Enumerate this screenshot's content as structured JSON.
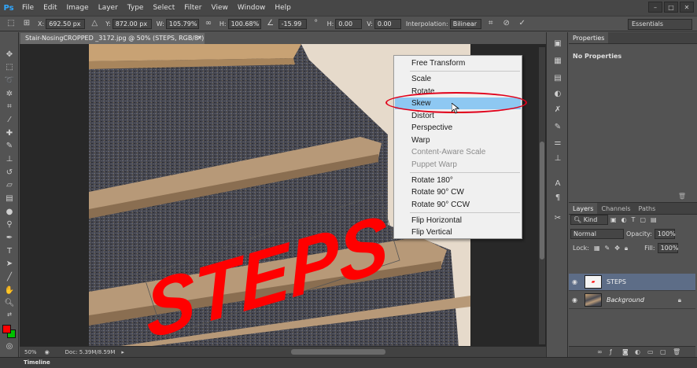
{
  "app": {
    "logo": "Ps",
    "menu": [
      "File",
      "Edit",
      "Image",
      "Layer",
      "Type",
      "Select",
      "Filter",
      "View",
      "Window",
      "Help"
    ],
    "window_controls": [
      "–",
      "□",
      "✕"
    ]
  },
  "options_bar": {
    "x_label": "X:",
    "x_value": "692.50 px",
    "y_label": "Y:",
    "y_value": "872.00 px",
    "w_label": "W:",
    "w_value": "105.79%",
    "h_label": "H:",
    "h_value": "100.68%",
    "angle_value": "-15.99",
    "hskew_label": "H:",
    "hskew_value": "0.00",
    "vskew_label": "V:",
    "vskew_value": "0.00",
    "interp_label": "Interpolation:",
    "interp_value": "Bilinear",
    "workspace": "Essentials"
  },
  "document": {
    "tab_title": "Stair-NosingCROPPED _3172.jpg @ 50% (STEPS, RGB/8*) *",
    "zoom": "50%",
    "doc_size": "Doc: 5.39M/8.59M",
    "steps_text": "STEPS"
  },
  "context_menu": {
    "items": [
      {
        "label": "Free Transform",
        "state": "normal"
      },
      {
        "label": "Scale",
        "state": "normal"
      },
      {
        "label": "Rotate",
        "state": "normal"
      },
      {
        "label": "Skew",
        "state": "selected"
      },
      {
        "label": "Distort",
        "state": "normal"
      },
      {
        "label": "Perspective",
        "state": "normal"
      },
      {
        "label": "Warp",
        "state": "normal"
      },
      {
        "label": "Content-Aware Scale",
        "state": "disabled"
      },
      {
        "label": "Puppet Warp",
        "state": "disabled"
      },
      {
        "label": "Rotate 180°",
        "state": "normal"
      },
      {
        "label": "Rotate 90° CW",
        "state": "normal"
      },
      {
        "label": "Rotate 90° CCW",
        "state": "normal"
      },
      {
        "label": "Flip Horizontal",
        "state": "normal"
      },
      {
        "label": "Flip Vertical",
        "state": "normal"
      }
    ]
  },
  "properties": {
    "tab": "Properties",
    "message": "No Properties"
  },
  "layers_panel": {
    "tabs": [
      "Layers",
      "Channels",
      "Paths"
    ],
    "kind_label": "Kind",
    "blend_mode": "Normal",
    "opacity_label": "Opacity:",
    "opacity_value": "100%",
    "lock_label": "Lock:",
    "fill_label": "Fill:",
    "fill_value": "100%",
    "layers": [
      {
        "name": "STEPS",
        "selected": true
      },
      {
        "name": "Background",
        "selected": false
      }
    ]
  },
  "timeline": {
    "label": "Timeline"
  },
  "colors": {
    "foreground": "#ff0000",
    "background": "#00c000",
    "menu_highlight": "#8ec8f2",
    "annotation": "#e0001a"
  }
}
